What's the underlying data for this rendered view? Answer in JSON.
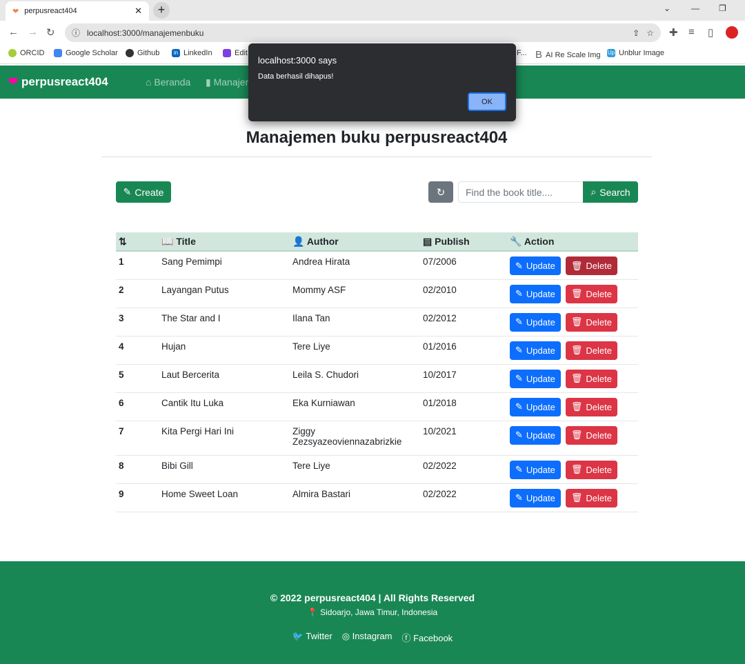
{
  "browser": {
    "tab_title": "perpusreact404",
    "url": "localhost:3000/manajemenbuku",
    "bookmarks": [
      {
        "label": "ORCID",
        "color": "#a6ce39"
      },
      {
        "label": "Google Scholar",
        "color": "#4285f4"
      },
      {
        "label": "Github",
        "color": "#333333"
      },
      {
        "label": "LinkedIn",
        "color": "#0a66c2"
      },
      {
        "label": "Edit",
        "color": "#7b3fe4"
      },
      {
        "label": "F...",
        "color": "#888888"
      },
      {
        "label": "AI Re Scale Img",
        "color": "#666666"
      },
      {
        "label": "Unblur Image",
        "color": "#2d9cdb"
      }
    ]
  },
  "navbar": {
    "brand": "perpusreact404",
    "links": [
      "Beranda",
      "Manajemen buku"
    ]
  },
  "page": {
    "title": "Manajemen buku perpusreact404",
    "create_label": "Create",
    "search_placeholder": "Find the book title....",
    "search_label": "Search"
  },
  "table": {
    "headers": [
      "",
      "Title",
      "Author",
      "Publish",
      "Action"
    ],
    "rows": [
      [
        "1",
        "Sang Pemimpi",
        "Andrea Hirata",
        "07/2006"
      ],
      [
        "2",
        "Layangan Putus",
        "Mommy ASF",
        "02/2010"
      ],
      [
        "3",
        "The Star and I",
        "Ilana Tan",
        "02/2012"
      ],
      [
        "4",
        "Hujan",
        "Tere Liye",
        "01/2016"
      ],
      [
        "5",
        "Laut Bercerita",
        "Leila S. Chudori",
        "10/2017"
      ],
      [
        "6",
        "Cantik Itu Luka",
        "Eka Kurniawan",
        "01/2018"
      ],
      [
        "7",
        "Kita Pergi Hari Ini",
        "Ziggy Zezsyazeoviennazabrizkie",
        "10/2021"
      ],
      [
        "8",
        "Bibi Gill",
        "Tere Liye",
        "02/2022"
      ],
      [
        "9",
        "Home Sweet Loan",
        "Almira Bastari",
        "02/2022"
      ]
    ],
    "update_label": "Update",
    "delete_label": "Delete"
  },
  "footer": {
    "copyright": "© 2022 perpusreact404 | All Rights Reserved",
    "location": "Sidoarjo, Jawa Timur, Indonesia",
    "links": [
      "Twitter",
      "Instagram",
      "Facebook"
    ]
  },
  "dialog": {
    "title": "localhost:3000 says",
    "message": "Data berhasil dihapus!",
    "ok_label": "OK"
  },
  "colors": {
    "primary": "#198754",
    "update": "#0d6efd",
    "delete": "#dc3545"
  }
}
